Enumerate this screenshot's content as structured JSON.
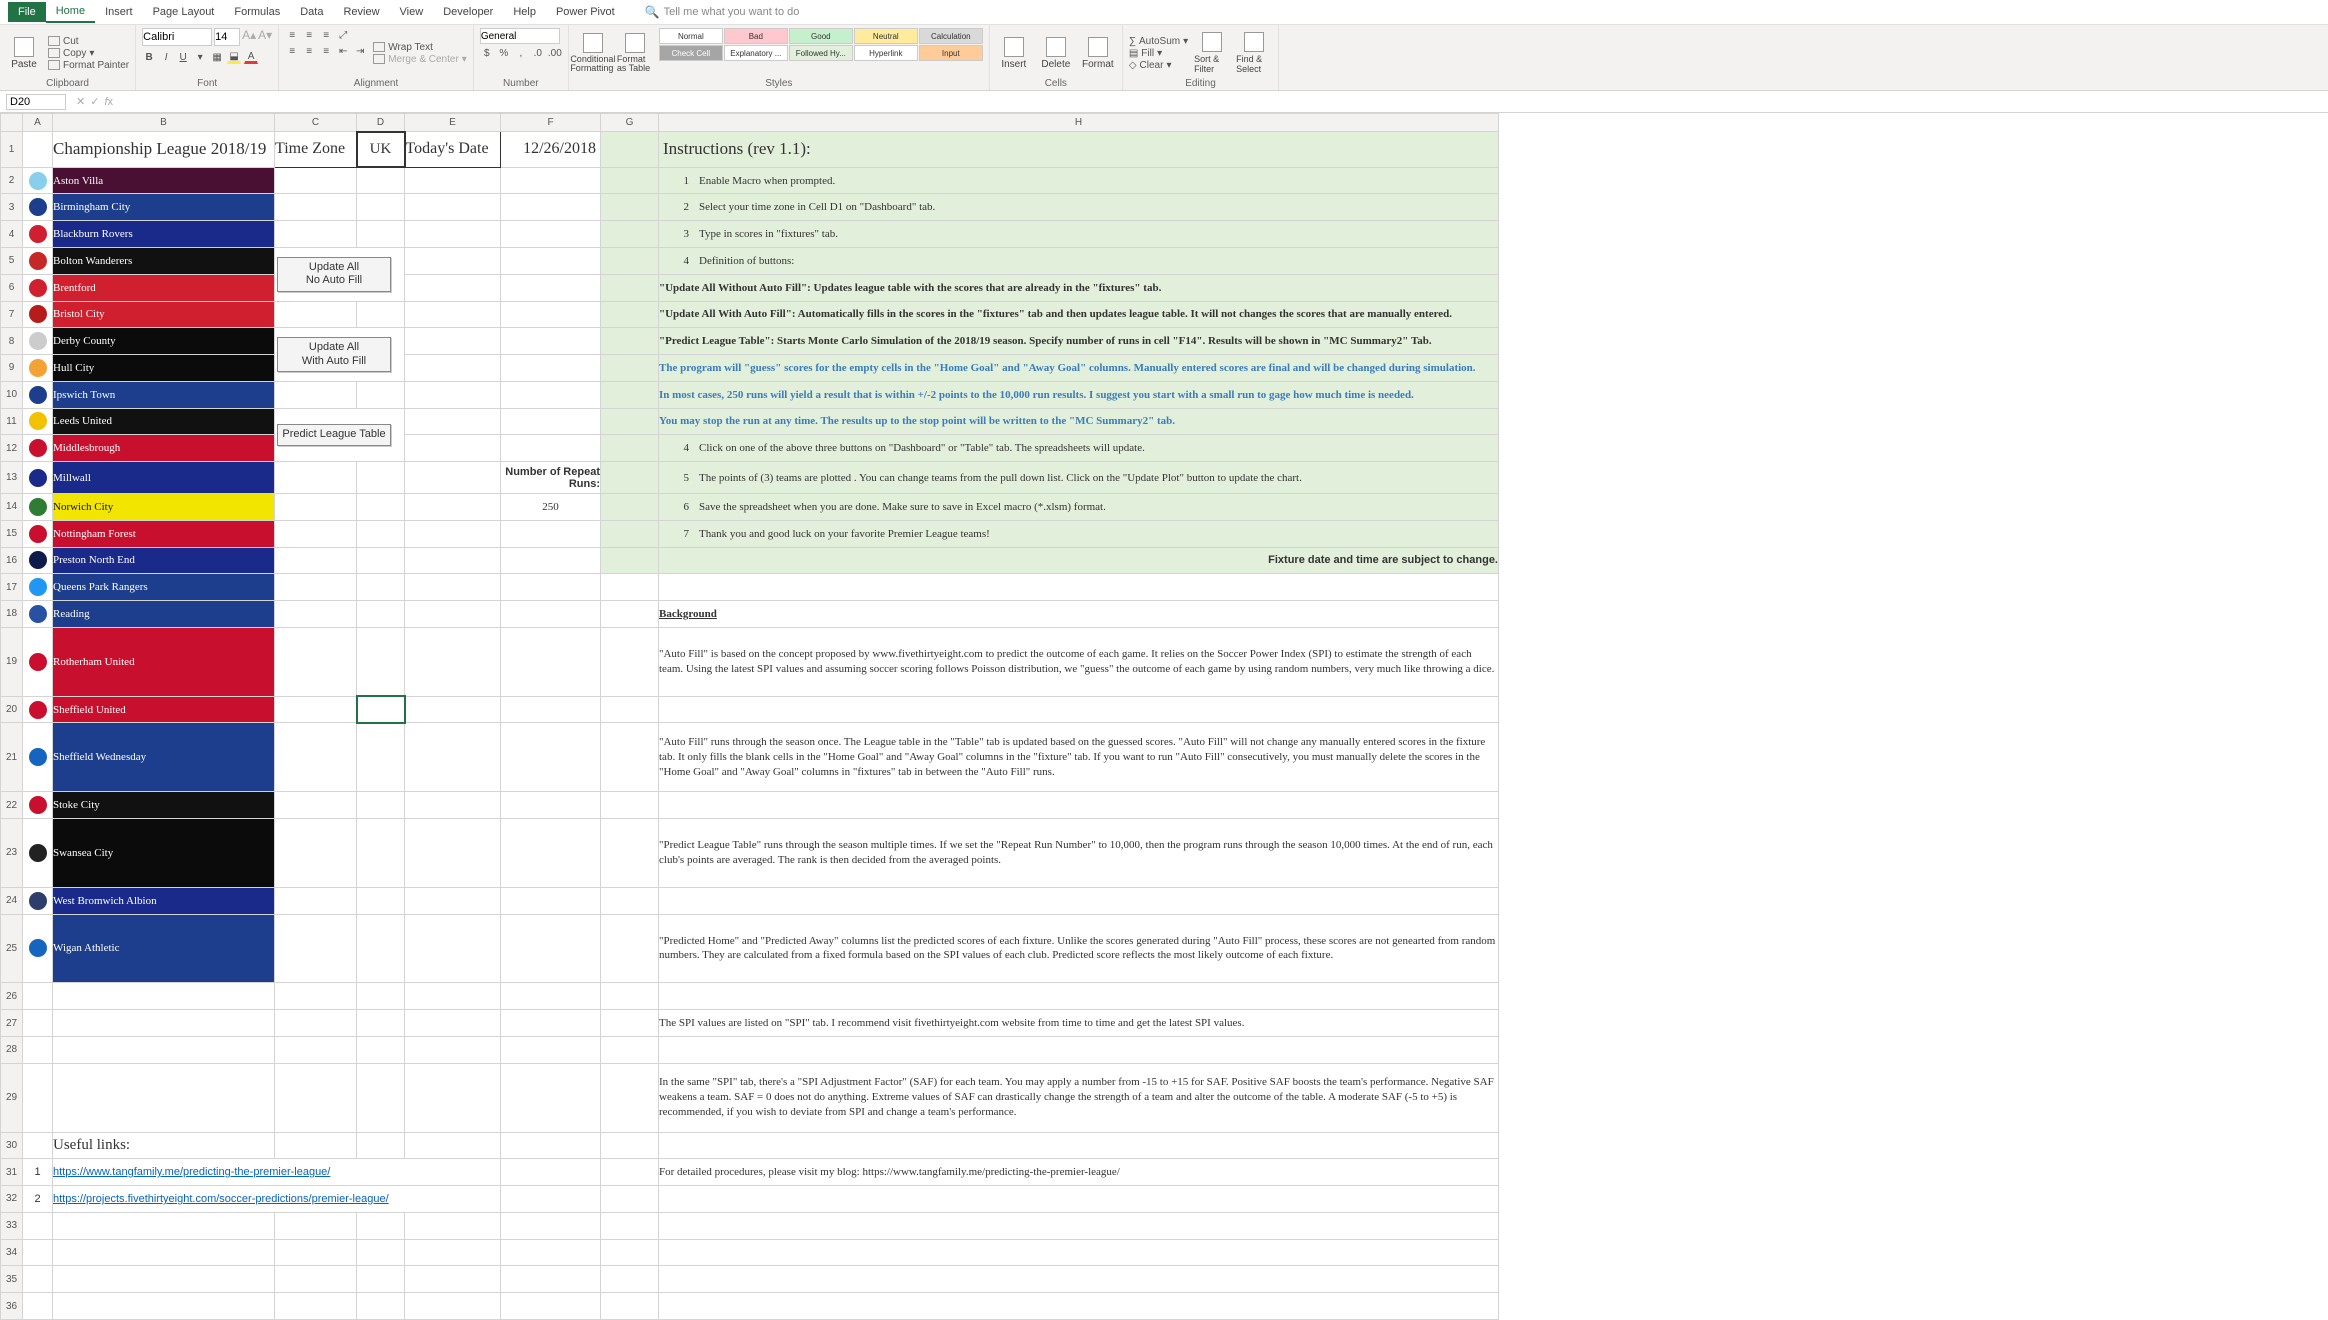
{
  "ribbon": {
    "tabs": [
      "File",
      "Home",
      "Insert",
      "Page Layout",
      "Formulas",
      "Data",
      "Review",
      "View",
      "Developer",
      "Help",
      "Power Pivot"
    ],
    "active": "Home",
    "tellme": "Tell me what you want to do",
    "clipboard": {
      "label": "Clipboard",
      "paste": "Paste",
      "cut": "Cut",
      "copy": "Copy",
      "painter": "Format Painter"
    },
    "font": {
      "label": "Font",
      "name": "Calibri",
      "size": "14"
    },
    "alignment": {
      "label": "Alignment",
      "wrap": "Wrap Text",
      "merge": "Merge & Center"
    },
    "number": {
      "label": "Number",
      "format": "General"
    },
    "styles": {
      "label": "Styles",
      "cond": "Conditional Formatting",
      "fmtTable": "Format as Table",
      "gallery": [
        "Normal",
        "Bad",
        "Good",
        "Neutral",
        "Calculation",
        "Check Cell",
        "Explanatory ...",
        "Followed Hy...",
        "Hyperlink",
        "Input"
      ]
    },
    "cells": {
      "label": "Cells",
      "insert": "Insert",
      "delete": "Delete",
      "format": "Format"
    },
    "editing": {
      "label": "Editing",
      "autosum": "AutoSum",
      "fill": "Fill",
      "clear": "Clear",
      "sort": "Sort & Filter",
      "find": "Find & Select"
    }
  },
  "namebox": "D20",
  "header": {
    "title": "Championship League 2018/19",
    "tzLabel": "Time Zone",
    "tz": "UK",
    "todayLabel": "Today's Date",
    "today": "12/26/2018"
  },
  "teams": [
    {
      "name": "Aston Villa",
      "bg": "#4a1033",
      "crest": "#87cfea"
    },
    {
      "name": "Birmingham City",
      "bg": "#1c3e8c",
      "crest": "#1c3e8c"
    },
    {
      "name": "Blackburn Rovers",
      "bg": "#1a2a8a",
      "crest": "#d01f2e"
    },
    {
      "name": "Bolton Wanderers",
      "bg": "#111111",
      "crest": "#c62828"
    },
    {
      "name": "Brentford",
      "bg": "#d01f2e",
      "crest": "#d01f2e"
    },
    {
      "name": "Bristol City",
      "bg": "#d01f2e",
      "crest": "#b71c1c"
    },
    {
      "name": "Derby County",
      "bg": "#0b0b0b",
      "crest": "#cccccc"
    },
    {
      "name": "Hull City",
      "bg": "#0b0b0b",
      "crest": "#f4a236"
    },
    {
      "name": "Ipswich Town",
      "bg": "#1c3e8c",
      "crest": "#1c3e8c"
    },
    {
      "name": "Leeds United",
      "bg": "#111111",
      "crest": "#f2c200"
    },
    {
      "name": "Middlesbrough",
      "bg": "#c8102e",
      "crest": "#c8102e"
    },
    {
      "name": "Millwall",
      "bg": "#1a2a8a",
      "crest": "#1a2a8a"
    },
    {
      "name": "Norwich City",
      "bg": "#f2e600",
      "crest": "#2e7d32",
      "fg": "#111"
    },
    {
      "name": "Nottingham Forest",
      "bg": "#c8102e",
      "crest": "#c8102e"
    },
    {
      "name": "Preston North End",
      "bg": "#1a2a8a",
      "crest": "#0d1b4c"
    },
    {
      "name": "Queens Park Rangers",
      "bg": "#1c3e8c",
      "crest": "#2196f3"
    },
    {
      "name": "Reading",
      "bg": "#1c3e8c",
      "crest": "#2951a3"
    },
    {
      "name": "Rotherham United",
      "bg": "#c8102e",
      "crest": "#c8102e"
    },
    {
      "name": "Sheffield United",
      "bg": "#c8102e",
      "crest": "#c8102e"
    },
    {
      "name": "Sheffield Wednesday",
      "bg": "#1c3e8c",
      "crest": "#1565c0"
    },
    {
      "name": "Stoke City",
      "bg": "#111111",
      "crest": "#c8102e"
    },
    {
      "name": "Swansea City",
      "bg": "#0b0b0b",
      "crest": "#222"
    },
    {
      "name": "West Bromwich Albion",
      "bg": "#1a2a8a",
      "crest": "#2d3e6a"
    },
    {
      "name": "Wigan Athletic",
      "bg": "#1c3e8c",
      "crest": "#1565c0"
    }
  ],
  "buttons": {
    "b1a": "Update All",
    "b1b": "No Auto Fill",
    "b2a": "Update All",
    "b2b": "With Auto Fill",
    "b3": "Predict League Table"
  },
  "repeat": {
    "label": "Number of Repeat Runs:",
    "value": "250"
  },
  "instructions": {
    "title": "Instructions (rev 1.1):",
    "items": [
      {
        "n": "1",
        "t": "Enable Macro when prompted."
      },
      {
        "n": "2",
        "t": "Select your time zone in Cell D1 on \"Dashboard\" tab."
      },
      {
        "n": "3",
        "t": "Type in scores in \"fixtures\" tab."
      },
      {
        "n": "4",
        "t": "Definition of buttons:"
      }
    ],
    "notesA": [
      "\"Update All Without Auto Fill\":  Updates league table with the scores that are already in the \"fixtures\" tab.",
      "\"Update All With Auto Fill\":  Automatically fills in the scores in the \"fixtures\" tab and then updates league table.  It will not changes the scores that are manually entered.",
      "\"Predict League Table\":  Starts Monte Carlo Simulation of the 2018/19 season.  Specify number of runs in cell \"F14\".  Results will be shown in \"MC Summary2\" Tab."
    ],
    "notesB": [
      "The program will \"guess\" scores for the empty cells in the \"Home Goal\" and \"Away Goal\" columns.  Manually entered scores are final and will be changed during simulation.",
      "In most cases, 250 runs will yield a result that is within +/-2 points to the 10,000 run results.  I suggest you start with a small run to gage how much time is needed.",
      "You may stop the run at any time.  The results up to the stop point will be written to the \"MC Summary2\" tab."
    ],
    "items2": [
      {
        "n": "4",
        "t": "Click on one of the above three buttons on \"Dashboard\" or \"Table\" tab.  The spreadsheets will update."
      },
      {
        "n": "5",
        "t": "The points of (3) teams are plotted .  You can change teams from the pull down list.  Click on the \"Update Plot\" button to update the chart."
      },
      {
        "n": "6",
        "t": "Save the spreadsheet when you are done.  Make sure to save in Excel macro (*.xlsm) format."
      },
      {
        "n": "7",
        "t": "Thank you and good luck on your favorite Premier League teams!"
      }
    ],
    "footer": "Fixture date and time are subject to change."
  },
  "background": {
    "title": "Background",
    "paras": [
      "\"Auto Fill\" is based on the concept proposed by www.fivethirtyeight.com to predict the outcome of each game. It relies on the Soccer Power Index (SPI) to estimate the strength of each team.  Using the latest SPI values and assuming soccer scoring follows Poisson distribution, we \"guess\" the outcome of each game by using random numbers, very much like throwing a dice.",
      "\"Auto Fill\" runs through the season once.  The League table in the \"Table\" tab is updated based on the guessed scores.  \"Auto Fill\" will not change any manually entered scores in the fixture tab.  It only fills the blank cells in the \"Home Goal\" and \"Away Goal\" columns in the \"fixture\" tab. If you want to run \"Auto Fill\" consecutively, you must manually delete the scores in the \"Home Goal\" and \"Away Goal\" columns in \"fixtures\" tab in between the \"Auto Fill\" runs.",
      "\"Predict League Table\" runs through the season multiple times.  If we set the \"Repeat Run Number\" to 10,000, then the program runs through the season 10,000 times.  At the end of run, each club's points are averaged.  The rank is then decided from the averaged points.",
      "\"Predicted Home\" and \"Predicted Away\" columns list the predicted scores of each fixture.   Unlike the scores generated during \"Auto Fill\" process, these scores are not genearted from random numbers.  They are calculated from a fixed formula based on the SPI values of each club.  Predicted score reflects the most likely outcome of each fixture.",
      "The SPI values are listed on \"SPI\" tab.  I recommend visit fivethirtyeight.com website from time to time and get the latest SPI values.",
      "In the same \"SPI\" tab, there's a \"SPI Adjustment Factor\" (SAF) for each team.  You may apply a number from -15 to +15 for SAF.  Positive SAF boosts the team's performance. Negative SAF weakens a team.  SAF = 0 does not do anything.  Extreme values of SAF can drastically change the strength of a team and alter the outcome of the table.  A moderate SAF (-5 to +5) is recommended, if you wish to deviate from SPI and change a team's performance.",
      "For detailed procedures, please visit my blog: https://www.tangfamily.me/predicting-the-premier-league/"
    ]
  },
  "links": {
    "label": "Useful links:",
    "items": [
      {
        "n": "1",
        "url": "https://www.tangfamily.me/predicting-the-premier-league/"
      },
      {
        "n": "2",
        "url": "https://projects.fivethirtyeight.com/soccer-predictions/premier-league/"
      }
    ]
  }
}
